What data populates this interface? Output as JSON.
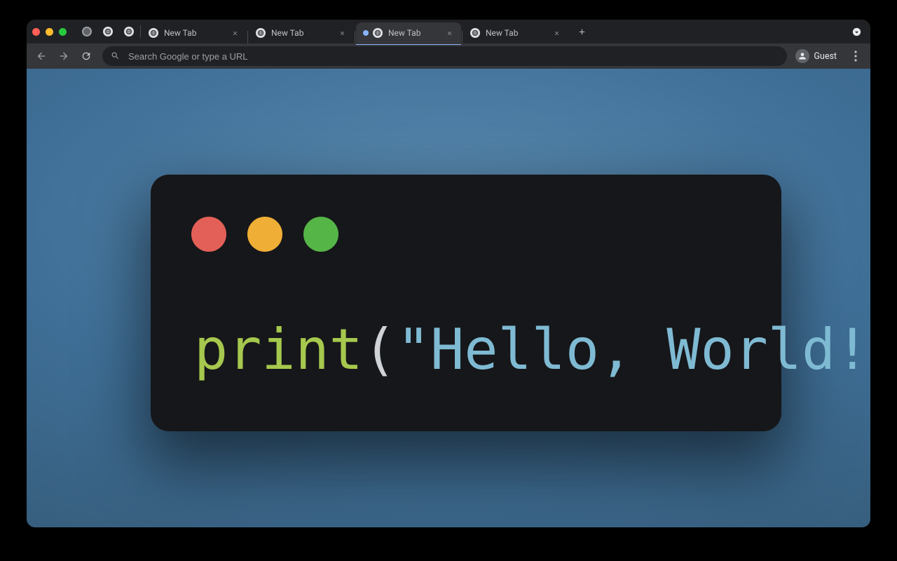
{
  "tabs": {
    "pinned": [
      {
        "favicon": "blank"
      },
      {
        "favicon": "globe"
      },
      {
        "favicon": "globe"
      }
    ],
    "open": [
      {
        "title": "New Tab",
        "active": false,
        "loading": false
      },
      {
        "title": "New Tab",
        "active": false,
        "loading": false
      },
      {
        "title": "New Tab",
        "active": true,
        "loading": true
      },
      {
        "title": "New Tab",
        "active": false,
        "loading": false
      }
    ]
  },
  "toolbar": {
    "omnibox_placeholder": "Search Google or type a URL",
    "profile_label": "Guest"
  },
  "page": {
    "code": {
      "func": "print",
      "open": "(",
      "str": "\"Hello, World!\"",
      "close": ")"
    }
  }
}
